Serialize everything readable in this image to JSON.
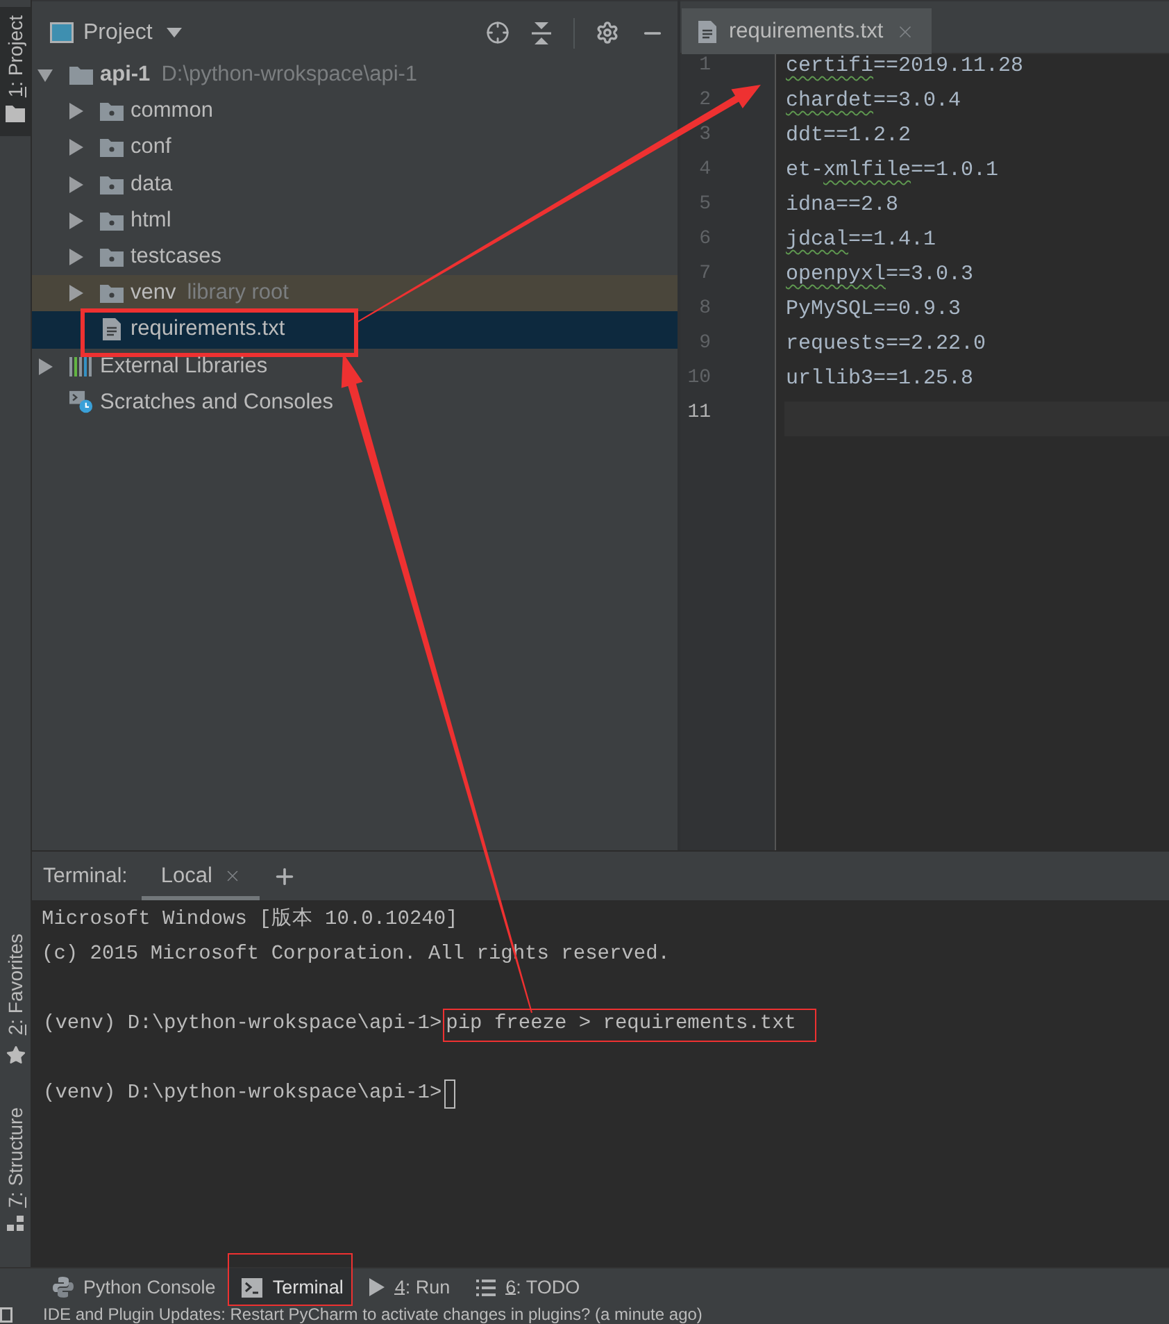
{
  "tool_window_bar": {
    "top": [
      {
        "kind": "project",
        "label": "1: Project",
        "mnemonic": true,
        "selected": true
      }
    ],
    "bottom": [
      {
        "kind": "favorites",
        "label": "2: Favorites",
        "mnemonic": true,
        "selected": false
      },
      {
        "kind": "structure",
        "label": "7: Structure",
        "mnemonic": true,
        "selected": false
      }
    ]
  },
  "project_panel": {
    "title": "Project",
    "tree": [
      {
        "kind": "project",
        "label": "api-1",
        "path": "D:\\python-wrokspace\\api-1",
        "expanded": true,
        "selected": false,
        "highlighted": false,
        "children": [
          {
            "kind": "folder",
            "label": "common",
            "expanded": false,
            "selected": false,
            "highlighted": false
          },
          {
            "kind": "folder",
            "label": "conf",
            "expanded": false,
            "selected": false,
            "highlighted": false
          },
          {
            "kind": "folder",
            "label": "data",
            "expanded": false,
            "selected": false,
            "highlighted": false
          },
          {
            "kind": "folder",
            "label": "html",
            "expanded": false,
            "selected": false,
            "highlighted": false
          },
          {
            "kind": "folder",
            "label": "testcases",
            "expanded": false,
            "selected": false,
            "highlighted": false
          },
          {
            "kind": "library-root",
            "label": "venv",
            "note": "library root",
            "expanded": false,
            "selected": false,
            "highlighted": false
          },
          {
            "kind": "file",
            "label": "requirements.txt",
            "selected": true,
            "highlighted": true
          }
        ]
      },
      {
        "kind": "libraries",
        "label": "External Libraries",
        "expanded": false,
        "selected": false,
        "highlighted": false
      },
      {
        "kind": "scratches",
        "label": "Scratches and Consoles",
        "selected": false,
        "highlighted": false
      }
    ]
  },
  "editor": {
    "tabs": [
      {
        "label": "requirements.txt",
        "selected": true
      }
    ],
    "lines": [
      {
        "number": "1",
        "current": false,
        "parts": [
          {
            "text": "certifi",
            "flagged": true
          },
          {
            "text": "==2019.11.28",
            "flagged": false
          }
        ]
      },
      {
        "number": "2",
        "current": false,
        "parts": [
          {
            "text": "chardet",
            "flagged": true
          },
          {
            "text": "==3.0.4",
            "flagged": false
          }
        ]
      },
      {
        "number": "3",
        "current": false,
        "parts": [
          {
            "text": "ddt==1.2.2",
            "flagged": false
          }
        ]
      },
      {
        "number": "4",
        "current": false,
        "parts": [
          {
            "text": "et-",
            "flagged": false
          },
          {
            "text": "xmlfile",
            "flagged": true
          },
          {
            "text": "==1.0.1",
            "flagged": false
          }
        ]
      },
      {
        "number": "5",
        "current": false,
        "parts": [
          {
            "text": "idna==2.8",
            "flagged": false
          }
        ]
      },
      {
        "number": "6",
        "current": false,
        "parts": [
          {
            "text": "jdcal",
            "flagged": true
          },
          {
            "text": "==1.4.1",
            "flagged": false
          }
        ]
      },
      {
        "number": "7",
        "current": false,
        "parts": [
          {
            "text": "openpyxl",
            "flagged": true
          },
          {
            "text": "==3.0.3",
            "flagged": false
          }
        ]
      },
      {
        "number": "8",
        "current": false,
        "parts": [
          {
            "text": "PyMySQL==0.9.3",
            "flagged": false
          }
        ]
      },
      {
        "number": "9",
        "current": false,
        "parts": [
          {
            "text": "requests==2.22.0",
            "flagged": false
          }
        ]
      },
      {
        "number": "10",
        "current": false,
        "parts": [
          {
            "text": "urllib3==1.25.8",
            "flagged": false
          }
        ]
      },
      {
        "number": "11",
        "current": true
      }
    ]
  },
  "terminal": {
    "title": "Terminal:",
    "tabs": [
      {
        "label": "Local",
        "selected": true
      }
    ],
    "lines": [
      {
        "kind": "output",
        "text": "Microsoft Windows [版本 10.0.10240]"
      },
      {
        "kind": "output",
        "text": "(c) 2015 Microsoft Corporation. All rights reserved."
      },
      {
        "kind": "prompt",
        "prompt": "(venv) D:\\python-wrokspace\\api-1>",
        "command": "pip freeze > requirements.txt",
        "highlighted": true,
        "cursor": false
      },
      {
        "kind": "prompt",
        "prompt": "(venv) D:\\python-wrokspace\\api-1>",
        "highlighted": false,
        "cursor": true
      }
    ]
  },
  "bottom_toolbar": [
    {
      "kind": "python-console",
      "label": "Python Console",
      "mnemonic": false,
      "selected": false,
      "highlighted": false
    },
    {
      "kind": "terminal",
      "label": "Terminal",
      "mnemonic": false,
      "selected": true,
      "highlighted": true
    },
    {
      "kind": "run",
      "label": "4: Run",
      "mnemonic": true,
      "selected": false,
      "highlighted": false
    },
    {
      "kind": "todo",
      "label": "6: TODO",
      "mnemonic": true,
      "selected": false,
      "highlighted": false
    }
  ],
  "status_bar": {
    "text": "IDE and Plugin Updates: Restart PyCharm to activate changes in plugins? (a minute ago)"
  }
}
